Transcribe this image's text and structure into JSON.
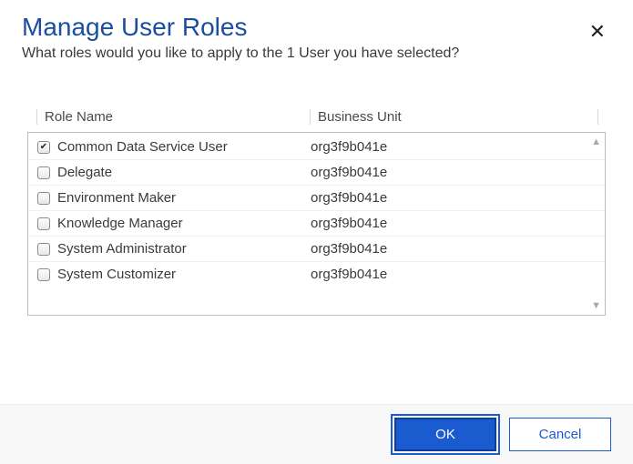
{
  "title": "Manage User Roles",
  "subtitle": "What roles would you like to apply to the 1 User you have selected?",
  "columns": {
    "role": "Role Name",
    "bu": "Business Unit"
  },
  "roles": [
    {
      "name": "Common Data Service User",
      "bu": "org3f9b041e",
      "checked": true
    },
    {
      "name": "Delegate",
      "bu": "org3f9b041e",
      "checked": false
    },
    {
      "name": "Environment Maker",
      "bu": "org3f9b041e",
      "checked": false
    },
    {
      "name": "Knowledge Manager",
      "bu": "org3f9b041e",
      "checked": false
    },
    {
      "name": "System Administrator",
      "bu": "org3f9b041e",
      "checked": false
    },
    {
      "name": "System Customizer",
      "bu": "org3f9b041e",
      "checked": false
    }
  ],
  "buttons": {
    "ok": "OK",
    "cancel": "Cancel"
  }
}
